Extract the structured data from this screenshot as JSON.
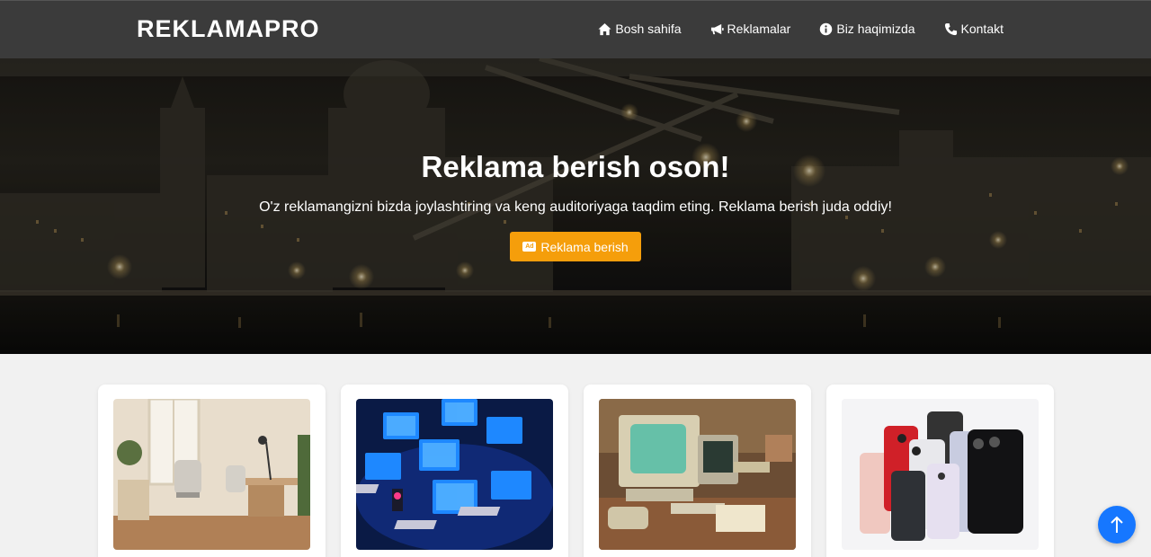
{
  "header": {
    "brand": "REKLAMAPRO",
    "nav": [
      {
        "label": "Bosh sahifa",
        "icon": "home-icon"
      },
      {
        "label": "Reklamalar",
        "icon": "bullhorn-icon"
      },
      {
        "label": "Biz haqimizda",
        "icon": "info-circle-icon"
      },
      {
        "label": "Kontakt",
        "icon": "phone-icon"
      }
    ]
  },
  "hero": {
    "title": "Reklama berish oson!",
    "subtitle": "O'z reklamangizni bizda joylashtiring va keng auditoriyaga taqdim eting. Reklama berish juda oddiy!",
    "cta_label": "Reklama berish",
    "cta_icon": "ad-icon",
    "background": "night-city-photo"
  },
  "cards": [
    {
      "image": "office-room-photo"
    },
    {
      "image": "computers-network-photo"
    },
    {
      "image": "retro-computers-photo"
    },
    {
      "image": "smartphones-photo"
    }
  ],
  "scroll_top": {
    "icon": "arrow-up-icon"
  },
  "colors": {
    "navbar": "#3b3b3b",
    "accent": "#f59e0b",
    "scroll_button": "#1677ff",
    "page_background": "#f1f1f1"
  }
}
